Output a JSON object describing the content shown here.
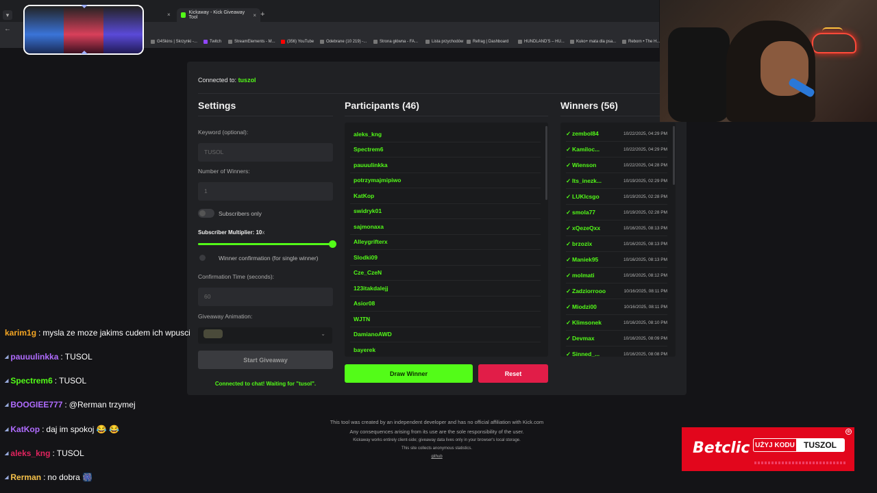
{
  "browser": {
    "tab1_close": "×",
    "tab2_title": "Kickaway - Kick Giveaway Tool",
    "tab2_close": "×",
    "new_tab": "+",
    "bookmarks": [
      "G4Skins | Skrzynki -...",
      "Twitch",
      "StreamElements - M...",
      "(356) YouTube",
      "Odebrane (10 219) -...",
      "Strona główna - FA...",
      "Lista przychodów",
      "Refrag | Dashboard",
      "HUNDLAND'S – HU...",
      "Kuko+ mata dla psa...",
      "Reborn • The H..."
    ]
  },
  "app": {
    "connected_label": "Connected to:",
    "connected_user": "tuszol",
    "settings": {
      "title": "Settings",
      "keyword_label": "Keyword (optional):",
      "keyword_value": "TUSOL",
      "winners_label": "Number of Winners:",
      "winners_value": "1",
      "subs_only_label": "Subscribers only",
      "multiplier_label": "Subscriber Multiplier:",
      "multiplier_value": "10",
      "multiplier_suffix": "x",
      "multiplier_level": 1.0,
      "confirm_label": "Winner confirmation (for single winner)",
      "confirm_time_label": "Confirmation Time (seconds):",
      "confirm_time_value": "60",
      "animation_label": "Giveaway Animation:",
      "start_button": "Start Giveaway",
      "status": "Connected to chat! Waiting for \"tusol\"."
    },
    "participants": {
      "title": "Participants (46)",
      "items": [
        "aleks_kng",
        "Spectrem6",
        "pauuulinkka",
        "potrzymajmipiwo",
        "KatKop",
        "swidryk01",
        "sajmonaxa",
        "Alleygrifterx",
        "Slodki09",
        "Cze_CzeN",
        "123itakdalejj",
        "Asior08",
        "WJTN",
        "DamianoAWD",
        "bayerek"
      ],
      "draw_button": "Draw Winner",
      "reset_button": "Reset"
    },
    "winners": {
      "title": "Winners (56)",
      "check": "✓",
      "items": [
        {
          "name": "zembol84",
          "date": "10/22/2025, 04:29 PM"
        },
        {
          "name": "Kamiloc...",
          "date": "10/22/2025, 04:29 PM"
        },
        {
          "name": "Wienson",
          "date": "10/22/2025, 04:28 PM"
        },
        {
          "name": "Its_inezk...",
          "date": "10/19/2025, 02:29 PM"
        },
        {
          "name": "LUKIcsgo",
          "date": "10/19/2025, 02:28 PM"
        },
        {
          "name": "smola77",
          "date": "10/19/2025, 02:28 PM"
        },
        {
          "name": "xQezeQxx",
          "date": "10/16/2025, 08:13 PM"
        },
        {
          "name": "brzozix",
          "date": "10/16/2025, 08:13 PM"
        },
        {
          "name": "Maniek95",
          "date": "10/16/2025, 08:13 PM"
        },
        {
          "name": "molmati",
          "date": "10/16/2025, 08:12 PM"
        },
        {
          "name": "Zadziorrooo",
          "date": "10/16/2025, 08:11 PM"
        },
        {
          "name": "Miodzi00",
          "date": "10/16/2025, 08:11 PM"
        },
        {
          "name": "Klimsonek",
          "date": "10/16/2025, 08:10 PM"
        },
        {
          "name": "Devmax",
          "date": "10/16/2025, 08:09 PM"
        },
        {
          "name": "Sinned_...",
          "date": "10/16/2025, 08:08 PM"
        }
      ]
    },
    "footer": {
      "line1": "This tool was created by an independent developer and has no official affiliation with Kick.com",
      "line2": "Any consequences arising from its use are the sole responsibility of the user.",
      "line3": "Kickaway works entirely client-side; giveaway data lives only in your browser's local storage.",
      "line4": "This site collects anonymous statistics.",
      "link": "github"
    }
  },
  "chat": [
    {
      "user": "karim1g",
      "color": "#f5a623",
      "text": "mysla ze moze jakims cudem ich wpusci"
    },
    {
      "user": "pauuulinkka",
      "color": "#b06cff",
      "text": "TUSOL"
    },
    {
      "user": "Spectrem6",
      "color": "#53fc18",
      "text": "TUSOL"
    },
    {
      "user": "BOOGIEE777",
      "color": "#b06cff",
      "text": "@Rerman trzymej"
    },
    {
      "user": "KatKop",
      "color": "#b06cff",
      "text": "daj im spokoj 😂 😂"
    },
    {
      "user": "aleks_kng",
      "color": "#e0245e",
      "text": "TUSOL"
    },
    {
      "user": "Rerman",
      "color": "#f5c14a",
      "text": "no dobra 🎆"
    }
  ],
  "ad": {
    "brand": "Betclic",
    "code_label": "UŻYJ KODU",
    "code": "TUSZOL",
    "close": "⊗"
  },
  "colors": {
    "accent": "#53fc18",
    "danger": "#e11d48",
    "card": "#202124"
  }
}
